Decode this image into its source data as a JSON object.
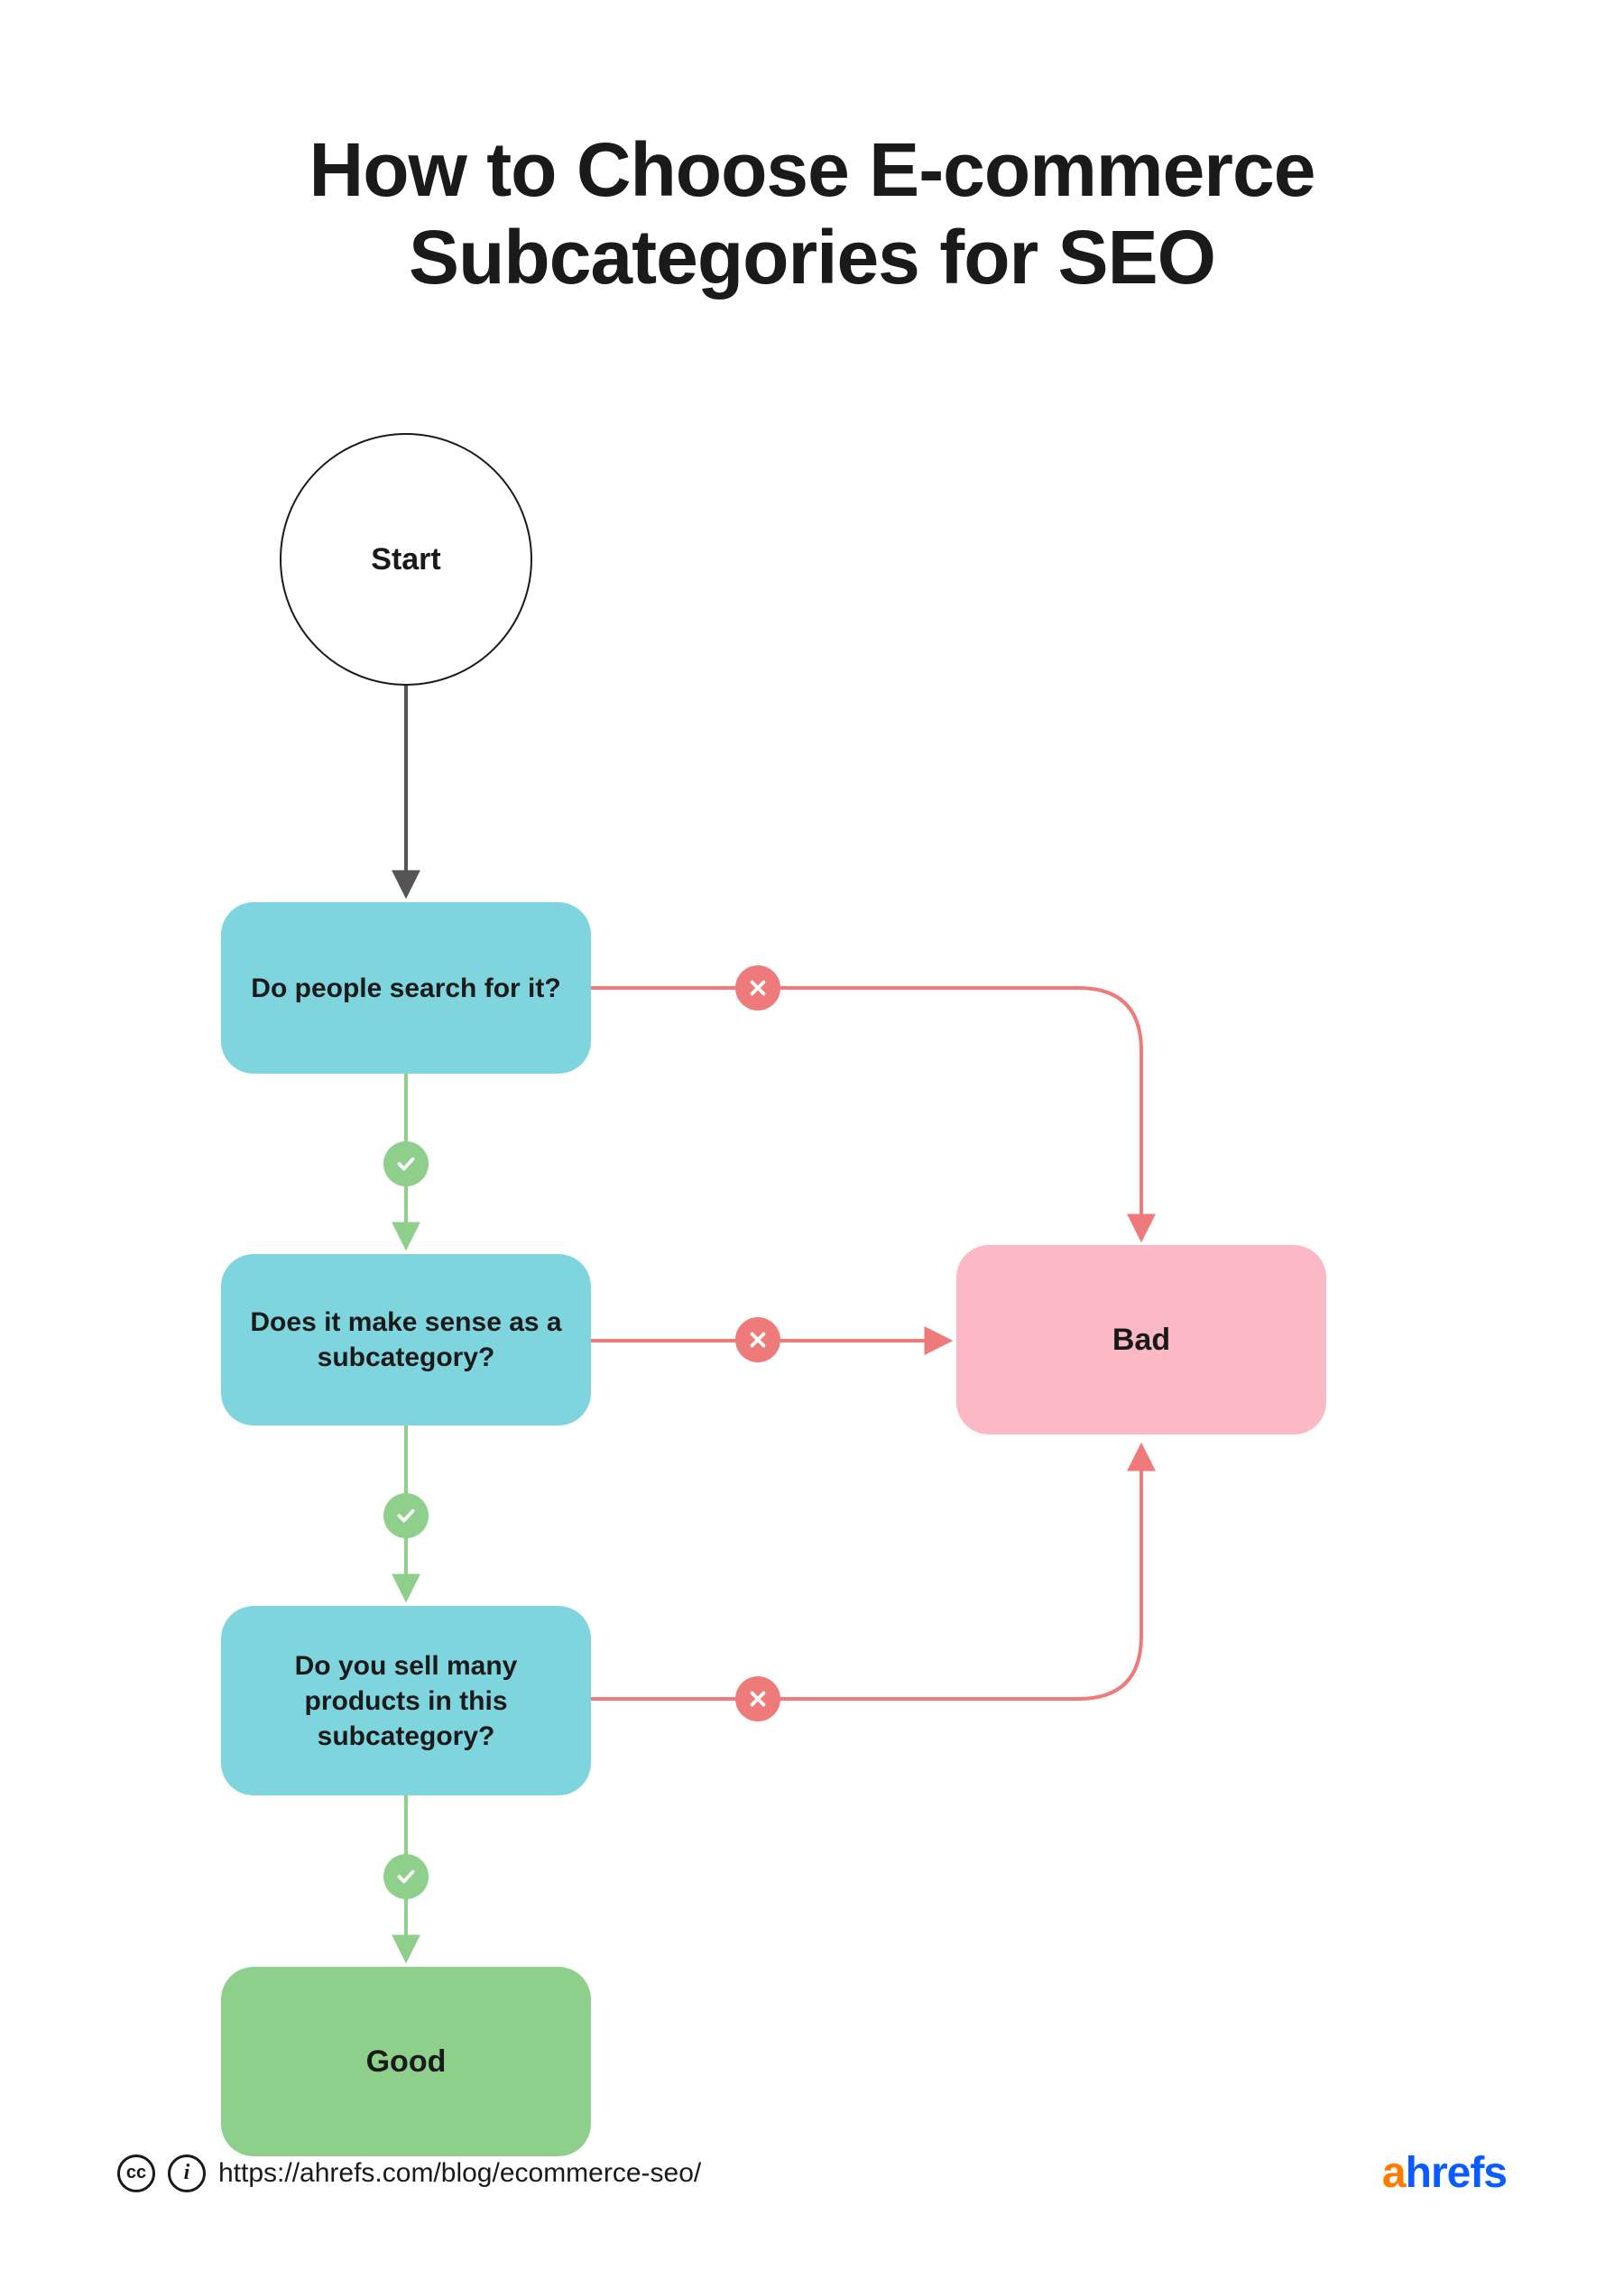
{
  "title": {
    "line1": "How to Choose E-commerce",
    "line2": "Subcategories for SEO"
  },
  "nodes": {
    "start": "Start",
    "q1": "Do people search for it?",
    "q2": "Does it make sense as a subcategory?",
    "q3": "Do you sell many products in this subcategory?",
    "good": "Good",
    "bad": "Bad"
  },
  "footer": {
    "url": "https://ahrefs.com/blog/ecommerce-seo/"
  },
  "brand": {
    "first": "a",
    "rest": "hrefs"
  },
  "colors": {
    "question": "#7fd5de",
    "good": "#8ed08b",
    "bad_fill": "#fbb8c5",
    "bad_stroke": "#ee7a7a",
    "yes_stroke": "#8ed08b",
    "start_arrow": "#555555"
  },
  "chart_data": {
    "type": "flowchart",
    "nodes": [
      {
        "id": "start",
        "kind": "terminator",
        "label": "Start"
      },
      {
        "id": "q1",
        "kind": "decision",
        "label": "Do people search for it?"
      },
      {
        "id": "q2",
        "kind": "decision",
        "label": "Does it make sense as a subcategory?"
      },
      {
        "id": "q3",
        "kind": "decision",
        "label": "Do you sell many products in this subcategory?"
      },
      {
        "id": "good",
        "kind": "result",
        "label": "Good",
        "color": "#8ed08b"
      },
      {
        "id": "bad",
        "kind": "result",
        "label": "Bad",
        "color": "#fbb8c5"
      }
    ],
    "edges": [
      {
        "from": "start",
        "to": "q1"
      },
      {
        "from": "q1",
        "to": "q2",
        "label": "yes"
      },
      {
        "from": "q2",
        "to": "q3",
        "label": "yes"
      },
      {
        "from": "q3",
        "to": "good",
        "label": "yes"
      },
      {
        "from": "q1",
        "to": "bad",
        "label": "no"
      },
      {
        "from": "q2",
        "to": "bad",
        "label": "no"
      },
      {
        "from": "q3",
        "to": "bad",
        "label": "no"
      }
    ]
  }
}
